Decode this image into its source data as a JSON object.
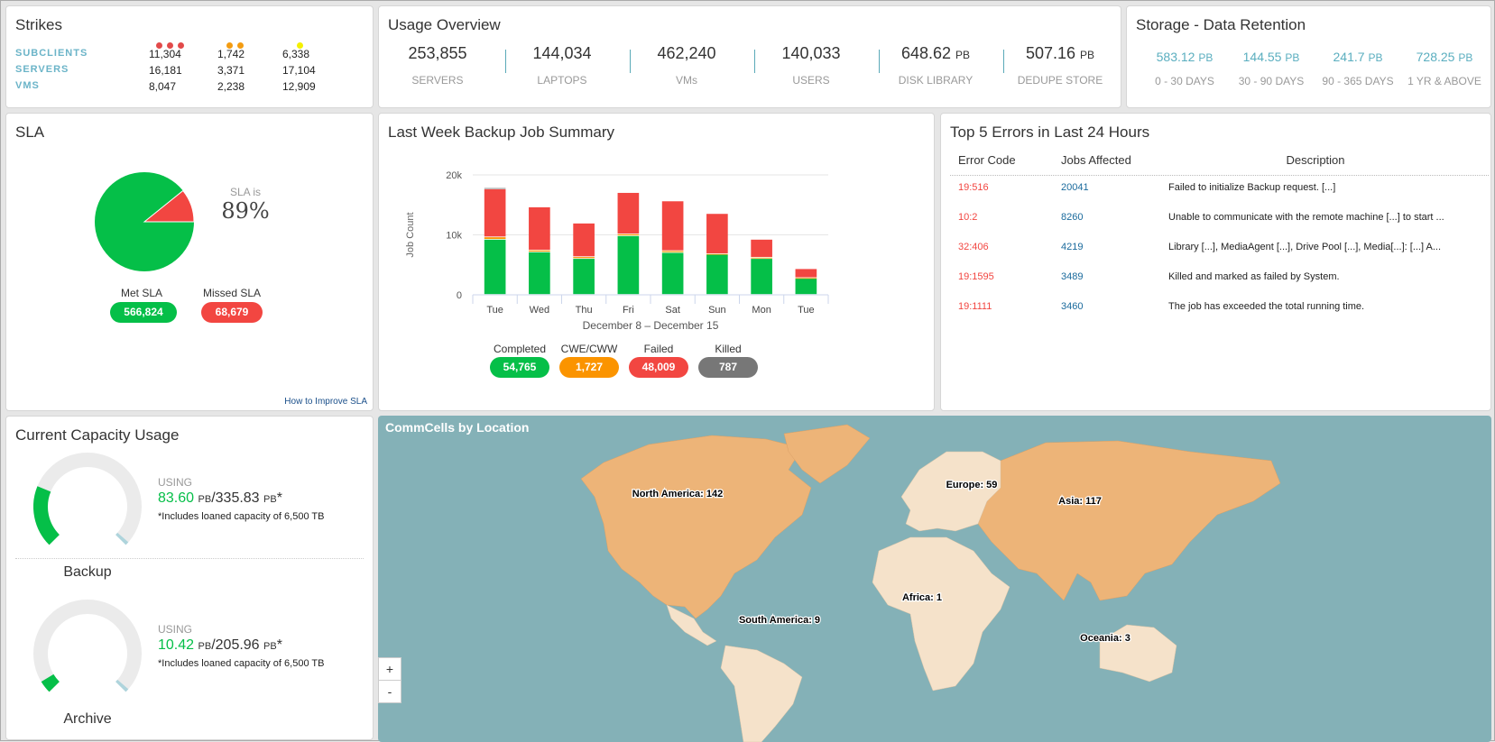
{
  "strikes": {
    "title": "Strikes",
    "headers": [
      {
        "dots": 3,
        "color": "#e24a4a"
      },
      {
        "dots": 2,
        "color": "#f39c12"
      },
      {
        "dots": 1,
        "color": "#f4f000"
      }
    ],
    "rows": [
      {
        "label": "SUBCLIENTS",
        "values": [
          "11,304",
          "1,742",
          "6,338"
        ]
      },
      {
        "label": "SERVERS",
        "values": [
          "16,181",
          "3,371",
          "17,104"
        ]
      },
      {
        "label": "VMS",
        "values": [
          "8,047",
          "2,238",
          "12,909"
        ]
      }
    ]
  },
  "usage": {
    "title": "Usage Overview",
    "items": [
      {
        "value": "253,855",
        "unit": "",
        "label": "SERVERS"
      },
      {
        "value": "144,034",
        "unit": "",
        "label": "LAPTOPS"
      },
      {
        "value": "462,240",
        "unit": "",
        "label": "VMs"
      },
      {
        "value": "140,033",
        "unit": "",
        "label": "USERS"
      },
      {
        "value": "648.62",
        "unit": "PB",
        "label": "DISK LIBRARY"
      },
      {
        "value": "507.16",
        "unit": "PB",
        "label": "DEDUPE STORE"
      }
    ]
  },
  "storage": {
    "title": "Storage - Data Retention",
    "items": [
      {
        "value": "583.12",
        "unit": "PB",
        "label": "0 - 30 DAYS"
      },
      {
        "value": "144.55",
        "unit": "PB",
        "label": "30 - 90 DAYS"
      },
      {
        "value": "241.7",
        "unit": "PB",
        "label": "90 - 365 DAYS"
      },
      {
        "value": "728.25",
        "unit": "PB",
        "label": "1 YR & ABOVE"
      }
    ]
  },
  "sla": {
    "title": "SLA",
    "sla_is": "SLA is",
    "percent": "89%",
    "met_label": "Met SLA",
    "met_value": "566,824",
    "missed_label": "Missed SLA",
    "missed_value": "68,679",
    "met_fraction": 0.892,
    "link": "How to Improve SLA",
    "colors": {
      "met": "#05bf48",
      "missed": "#f24641"
    }
  },
  "jobs": {
    "title": "Last Week Backup Job Summary",
    "legend": [
      {
        "label": "Completed",
        "value": "54,765",
        "color": "#05bf48"
      },
      {
        "label": "CWE/CWW",
        "value": "1,727",
        "color": "#fb9400"
      },
      {
        "label": "Failed",
        "value": "48,009",
        "color": "#f24641"
      },
      {
        "label": "Killed",
        "value": "787",
        "color": "#777777"
      }
    ]
  },
  "chart_data": {
    "type": "bar",
    "stacked": true,
    "categories": [
      "Tue",
      "Wed",
      "Thu",
      "Fri",
      "Sat",
      "Sun",
      "Mon",
      "Tue"
    ],
    "xlabel": "December 8 – December 15",
    "ylabel": "Job Count",
    "ylim": [
      0,
      20000
    ],
    "yticks": [
      "0",
      "10k",
      "20k"
    ],
    "grid": true,
    "series": [
      {
        "name": "Completed",
        "values": [
          9200,
          7100,
          6000,
          9800,
          7000,
          6700,
          6000,
          2700
        ]
      },
      {
        "name": "CWE/CWW",
        "values": [
          400,
          300,
          300,
          300,
          300,
          100,
          200,
          100
        ]
      },
      {
        "name": "Failed",
        "values": [
          8000,
          7200,
          5600,
          6900,
          8300,
          6700,
          3000,
          1500
        ]
      },
      {
        "name": "Killed",
        "values": [
          200,
          0,
          0,
          0,
          0,
          0,
          0,
          0
        ]
      }
    ]
  },
  "errors": {
    "title": "Top 5 Errors in Last 24 Hours",
    "headers": [
      "Error Code",
      "Jobs Affected",
      "Description"
    ],
    "rows": [
      {
        "code": "19:516",
        "jobs": "20041",
        "desc": "Failed to initialize Backup request. [...]"
      },
      {
        "code": "10:2",
        "jobs": "8260",
        "desc": "Unable to communicate with the remote machine [...] to start ..."
      },
      {
        "code": "32:406",
        "jobs": "4219",
        "desc": "Library [...], MediaAgent [...], Drive Pool [...], Media[...]: [...] A..."
      },
      {
        "code": "19:1595",
        "jobs": "3489",
        "desc": "Killed and marked as failed by System."
      },
      {
        "code": "19:1111",
        "jobs": "3460",
        "desc": "The job has exceeded the total running time."
      }
    ]
  },
  "capacity": {
    "title": "Current Capacity Usage",
    "items": [
      {
        "name": "Backup",
        "using": "USING",
        "used": "83.60",
        "total": "335.83",
        "unit": "PB",
        "note": "*Includes loaned capacity of 6,500 TB",
        "fraction": 0.249
      },
      {
        "name": "Archive",
        "using": "USING",
        "used": "10.42",
        "total": "205.96",
        "unit": "PB",
        "note": "*Includes loaned capacity of 6,500 TB",
        "fraction": 0.051
      }
    ]
  },
  "map": {
    "title": "CommCells by Location",
    "zoom_in": "+",
    "zoom_out": "-",
    "colors": {
      "ocean": "#84b1b7",
      "high": "#edb478",
      "low": "#f5e2ca"
    },
    "regions": [
      {
        "label": "North America: 142"
      },
      {
        "label": "Europe: 59"
      },
      {
        "label": "Asia: 117"
      },
      {
        "label": "Africa: 1"
      },
      {
        "label": "South America: 9"
      },
      {
        "label": "Oceania: 3"
      }
    ]
  }
}
